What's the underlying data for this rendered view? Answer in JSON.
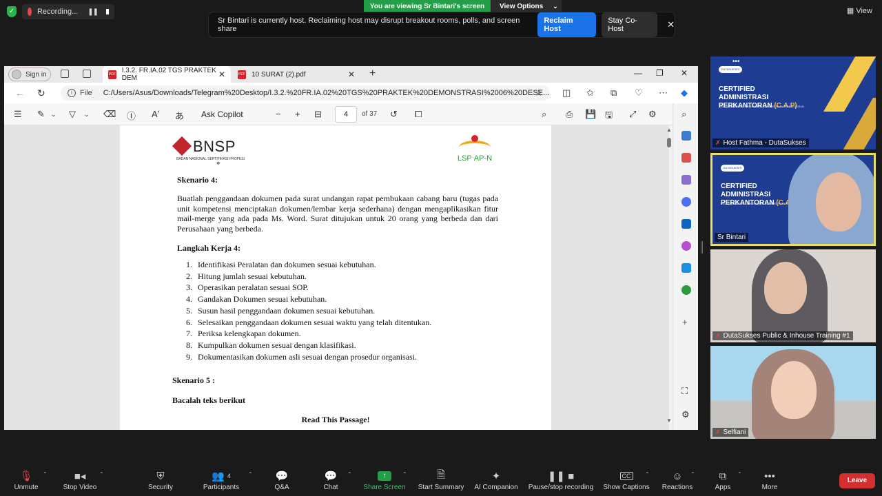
{
  "zoom": {
    "recording_label": "Recording...",
    "viewing_banner": "You are viewing Sr Bintari's screen",
    "view_options": "View Options",
    "view_label": "View",
    "host_banner": {
      "message": "Sr Bintari is currently host. Reclaiming host may disrupt breakout rooms, polls, and screen share",
      "reclaim": "Reclaim Host",
      "stay": "Stay Co-Host"
    }
  },
  "browser": {
    "signin": "Sign in",
    "tabs": [
      {
        "label": "I.3.2. FR.IA.02 TGS PRAKTEK DEM"
      },
      {
        "label": "10 SURAT (2).pdf"
      }
    ],
    "file_label": "File",
    "url": "C:/Users/Asus/Downloads/Telegram%20Desktop/I.3.2.%20FR.IA.02%20TGS%20PRAKTEK%20DEMONSTRASI%2006%20DESE...",
    "pdf": {
      "ask_copilot": "Ask Copilot",
      "page": "4",
      "of_pages": "of 37"
    }
  },
  "document": {
    "bnsp": "BNSP",
    "bnsp_sub": "BADAN NASIONAL SERTIFIKASI PROFESI",
    "lsp": "LSP",
    "lsp_apn": "AP-N",
    "skenario4": "Skenario 4:",
    "skenario4_body": "Buatlah penggandaan dokumen pada surat undangan rapat pembukaan cabang baru (tugas pada unit kompetensi menciptakan dokumen/lembar kerja sederhana) dengan mengaplikasikan fitur mail-merge yang ada pada Ms. Word. Surat ditujukan untuk 20 orang yang berbeda dan dari Perusahaan yang berbeda.",
    "langkah4": "Langkah Kerja 4:",
    "steps": [
      {
        "n": "1.",
        "text": "Identifikasi Peralatan dan dokumen sesuai kebutuhan."
      },
      {
        "n": "2.",
        "text": "Hitung jumlah sesuai kebutuhan."
      },
      {
        "n": "3.",
        "text": "Operasikan peralatan sesuai SOP."
      },
      {
        "n": "4.",
        "text": "Gandakan Dokumen sesuai kebutuhan."
      },
      {
        "n": "5.",
        "text": "Susun hasil penggandaan dokumen sesuai kebutuhan."
      },
      {
        "n": "6.",
        "text": "Selesaikan penggandaan dokumen sesuai waktu yang telah ditentukan."
      },
      {
        "n": "7.",
        "text": "Periksa kelengkapan dokumen."
      },
      {
        "n": "8.",
        "text": "Kumpulkan dokumen sesuai dengan klasifikasi."
      },
      {
        "n": "9.",
        "text": "Dokumentasikan dokumen asli sesuai dengan prosedur organisasi."
      }
    ],
    "skenario5": "Skenario 5 :",
    "bacalah": "Bacalah teks berikut",
    "read_passage": "Read This Passage!"
  },
  "participants": [
    {
      "name": "Host Fathma - DutaSukses"
    },
    {
      "name": "Sr Bintari"
    },
    {
      "name": "DutaSukses Public & Inhouse Training #1"
    },
    {
      "name": "Selfiani"
    }
  ],
  "slide": {
    "title_line1": "CERTIFIED",
    "title_line2": "ADMINISTRASI",
    "title_line3": "PERKANTORAN",
    "title_cap": "(C.A.P)",
    "subtitle": "PELATIHAN & SERTIFIKASI BNSP ADMINISTRASI PERKANTORAN",
    "logo": "DUTASUKSES"
  },
  "toolbar": {
    "unmute": "Unmute",
    "stop_video": "Stop Video",
    "security": "Security",
    "participants": "Participants",
    "participants_count": "4",
    "qa": "Q&A",
    "chat": "Chat",
    "share_screen": "Share Screen",
    "start_summary": "Start Summary",
    "ai_companion": "AI Companion",
    "pause_recording": "Pause/stop recording",
    "show_captions": "Show Captions",
    "reactions": "Reactions",
    "apps": "Apps",
    "more": "More",
    "leave": "Leave"
  },
  "colors": {
    "zoom_green": "#23a047",
    "reclaim_blue": "#1a73e8",
    "leave_red": "#d32f2f",
    "active_speaker": "#e6e06a",
    "slide_blue": "#1d3c92"
  }
}
